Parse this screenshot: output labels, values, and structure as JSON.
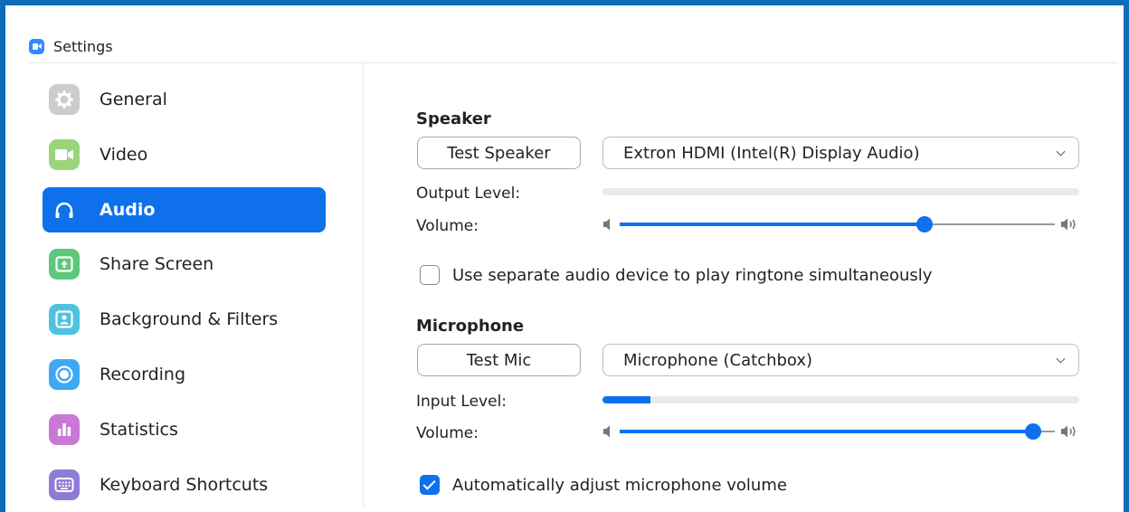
{
  "window": {
    "title": "Settings"
  },
  "sidebar": {
    "items": [
      {
        "label": "General",
        "icon": "gear-icon",
        "color": "#cccccc",
        "active": false
      },
      {
        "label": "Video",
        "icon": "video-camera-icon",
        "color": "#9bd37a",
        "active": false
      },
      {
        "label": "Audio",
        "icon": "headphones-icon",
        "color": "#0e71eb",
        "active": true
      },
      {
        "label": "Share Screen",
        "icon": "share-screen-icon",
        "color": "#5ec77b",
        "active": false
      },
      {
        "label": "Background & Filters",
        "icon": "background-icon",
        "color": "#4dc3e0",
        "active": false
      },
      {
        "label": "Recording",
        "icon": "record-icon",
        "color": "#3ea8f4",
        "active": false
      },
      {
        "label": "Statistics",
        "icon": "bar-chart-icon",
        "color": "#c879d6",
        "active": false
      },
      {
        "label": "Keyboard Shortcuts",
        "icon": "keyboard-icon",
        "color": "#8e7bd6",
        "active": false
      }
    ]
  },
  "speaker": {
    "title": "Speaker",
    "test_button": "Test Speaker",
    "device": "Extron HDMI (Intel(R) Display Audio)",
    "output_level_label": "Output Level:",
    "output_level": 0,
    "volume_label": "Volume:",
    "volume": 0.7
  },
  "ringtone": {
    "label": "Use separate audio device to play ringtone simultaneously",
    "checked": false
  },
  "microphone": {
    "title": "Microphone",
    "test_button": "Test Mic",
    "device": "Microphone (Catchbox)",
    "input_level_label": "Input Level:",
    "input_level": 0.1,
    "volume_label": "Volume:",
    "volume": 0.95
  },
  "auto_adjust": {
    "label": "Automatically adjust microphone volume",
    "checked": true
  },
  "colors": {
    "accent": "#0e71eb",
    "window_border": "#0f6cbd"
  }
}
